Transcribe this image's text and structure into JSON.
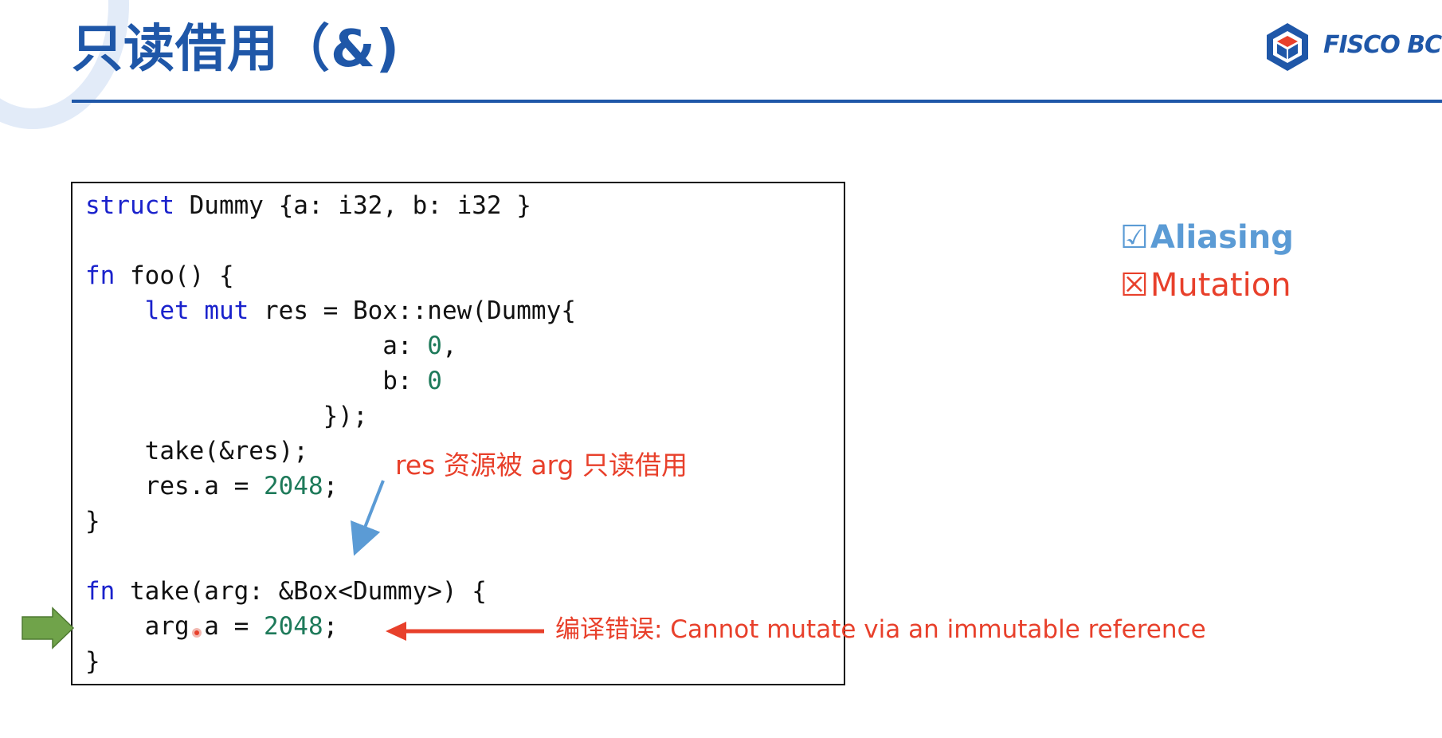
{
  "slide": {
    "title": "只读借用（&)",
    "logo_text": "FISCO BCOS"
  },
  "code": {
    "lines": [
      [
        {
          "t": "struct",
          "c": "kw"
        },
        {
          "t": " Dummy {a: i32, b: i32 }",
          "c": ""
        }
      ],
      [],
      [
        {
          "t": "fn",
          "c": "kw"
        },
        {
          "t": " foo() {",
          "c": ""
        }
      ],
      [
        {
          "t": "    ",
          "c": ""
        },
        {
          "t": "let",
          "c": "kw"
        },
        {
          "t": " ",
          "c": ""
        },
        {
          "t": "mut",
          "c": "kw"
        },
        {
          "t": " res = Box::new(Dummy{",
          "c": ""
        }
      ],
      [
        {
          "t": "                    a: ",
          "c": ""
        },
        {
          "t": "0",
          "c": "num"
        },
        {
          "t": ",",
          "c": ""
        }
      ],
      [
        {
          "t": "                    b: ",
          "c": ""
        },
        {
          "t": "0",
          "c": "num"
        }
      ],
      [
        {
          "t": "                });",
          "c": ""
        }
      ],
      [
        {
          "t": "    take(&res);",
          "c": ""
        }
      ],
      [
        {
          "t": "    res.a = ",
          "c": ""
        },
        {
          "t": "2048",
          "c": "num"
        },
        {
          "t": ";",
          "c": ""
        }
      ],
      [
        {
          "t": "}",
          "c": ""
        }
      ],
      [],
      [
        {
          "t": "fn",
          "c": "kw"
        },
        {
          "t": " take(arg: &Box<Dummy>) {",
          "c": ""
        }
      ],
      [
        {
          "t": "    arg.a = ",
          "c": ""
        },
        {
          "t": "2048",
          "c": "num"
        },
        {
          "t": ";",
          "c": ""
        }
      ],
      [
        {
          "t": "}",
          "c": ""
        }
      ]
    ]
  },
  "annotations": {
    "borrow_note": "res 资源被 arg 只读借用",
    "error_note": "编译错误: Cannot mutate via an immutable reference"
  },
  "legend": {
    "aliasing": {
      "icon": "☑",
      "label": "Aliasing"
    },
    "mutation": {
      "icon": "☒",
      "label": "Mutation"
    }
  },
  "colors": {
    "title_blue": "#1f57a8",
    "keyword_blue": "#1a22cc",
    "number_green": "#1e7a5a",
    "annotation_red": "#e8402b",
    "aliasing_blue": "#5b9bd5",
    "pointer_green": "#70a34a"
  },
  "icons": [
    "fisco-bcos-logo-icon",
    "blue-arrow-icon",
    "red-arrow-icon",
    "green-pointer-arrow-icon",
    "cursor-dot-icon",
    "checkbox-checked-icon",
    "checkbox-crossed-icon"
  ]
}
